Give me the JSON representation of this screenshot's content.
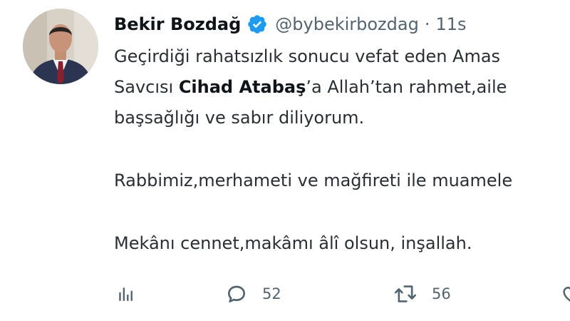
{
  "tweet": {
    "author": {
      "name": "Bekir Bozdağ",
      "handle": "@bybekirbozdag",
      "time": "11s"
    },
    "separator": "·",
    "text": {
      "line1": "Geçirdiği rahatsızlık sonucu vefat eden Amas",
      "line2_prefix": "Savcısı ",
      "line2_bold": "Cihad Atabaş",
      "line2_suffix": "’a Allah’tan rahmet,aile",
      "line3": "başsağlığı ve sabır diliyorum.",
      "line4": "Rabbimiz,merhameti ve mağfireti ile muamele",
      "line5": "Mekânı cennet,makâmı âlî olsun, inşallah."
    },
    "stats": {
      "replies": "52",
      "retweets": "56"
    },
    "icons": {
      "verified": "verified-badge-icon",
      "analytics": "analytics-icon",
      "reply": "reply-icon",
      "retweet": "retweet-icon",
      "like": "like-icon"
    },
    "colors": {
      "verified": "#1d9bf0",
      "secondary_text": "#536471",
      "primary_text": "#0f1419"
    }
  }
}
